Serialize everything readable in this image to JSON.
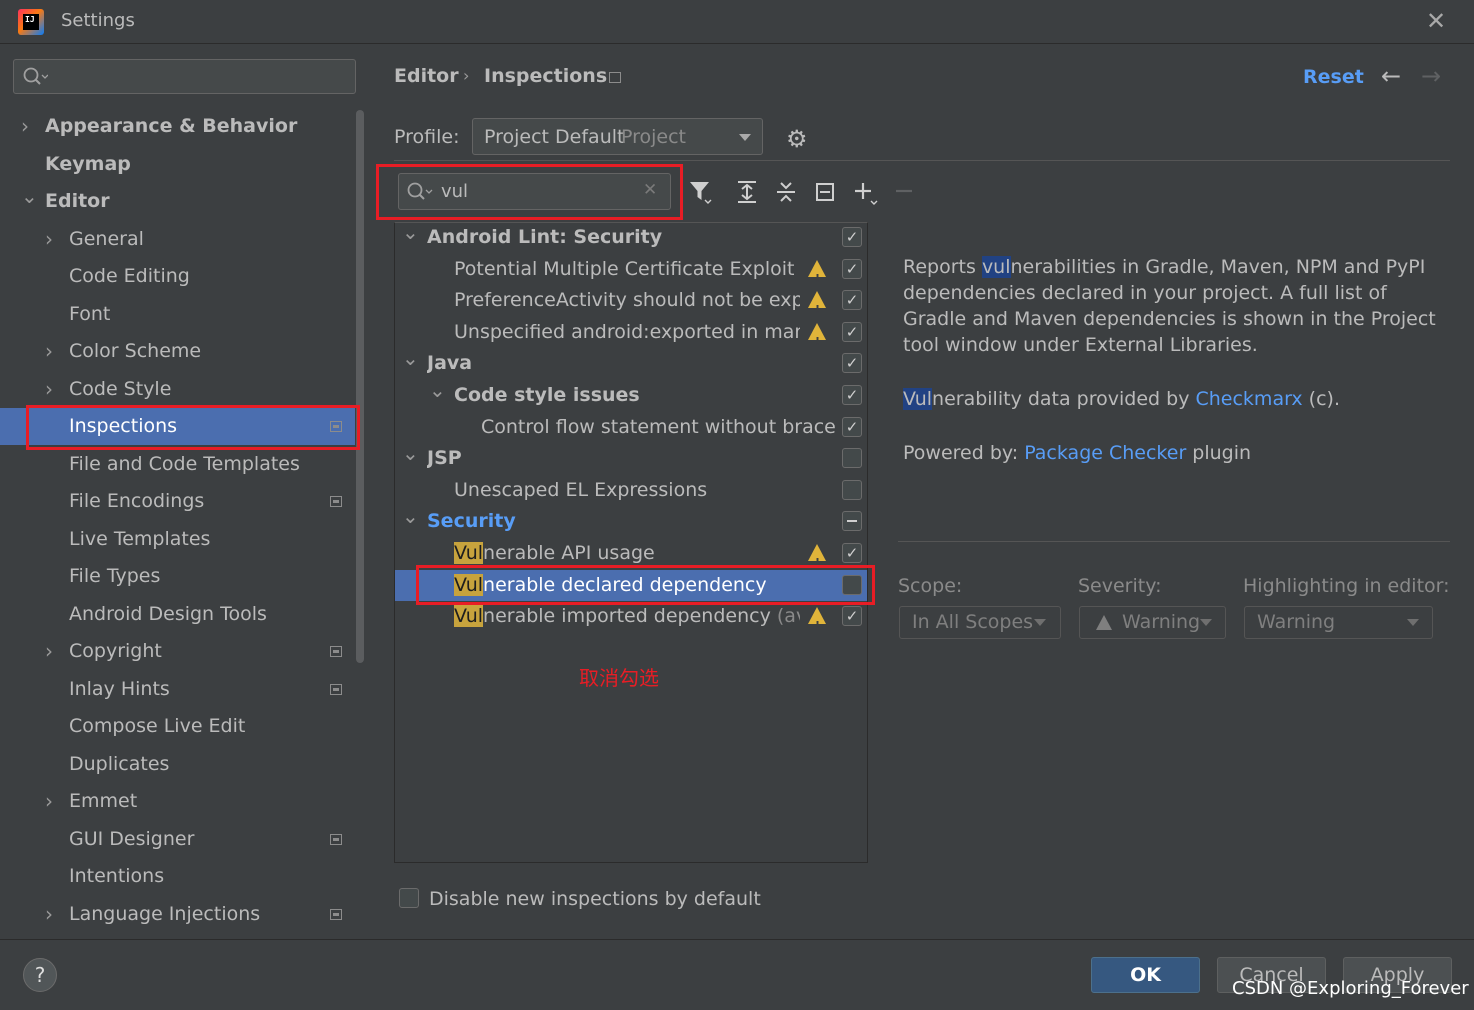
{
  "window": {
    "title": "Settings",
    "app_icon": "intellij-idea-icon",
    "close_icon": "close-icon"
  },
  "sidebar": {
    "search_placeholder": "",
    "items": [
      {
        "label": "Appearance & Behavior",
        "level": 0,
        "expandable": true,
        "expanded": false,
        "bold": true
      },
      {
        "label": "Keymap",
        "level": 0,
        "expandable": false,
        "bold": true
      },
      {
        "label": "Editor",
        "level": 0,
        "expandable": true,
        "expanded": true,
        "bold": true
      },
      {
        "label": "General",
        "level": 1,
        "expandable": true
      },
      {
        "label": "Code Editing",
        "level": 1
      },
      {
        "label": "Font",
        "level": 1
      },
      {
        "label": "Color Scheme",
        "level": 1,
        "expandable": true
      },
      {
        "label": "Code Style",
        "level": 1,
        "expandable": true
      },
      {
        "label": "Inspections",
        "level": 1,
        "selected": true,
        "modified": true
      },
      {
        "label": "File and Code Templates",
        "level": 1
      },
      {
        "label": "File Encodings",
        "level": 1,
        "modified": true
      },
      {
        "label": "Live Templates",
        "level": 1
      },
      {
        "label": "File Types",
        "level": 1
      },
      {
        "label": "Android Design Tools",
        "level": 1
      },
      {
        "label": "Copyright",
        "level": 1,
        "expandable": true,
        "modified": true
      },
      {
        "label": "Inlay Hints",
        "level": 1,
        "modified": true
      },
      {
        "label": "Compose Live Edit",
        "level": 1
      },
      {
        "label": "Duplicates",
        "level": 1
      },
      {
        "label": "Emmet",
        "level": 1,
        "expandable": true
      },
      {
        "label": "GUI Designer",
        "level": 1,
        "modified": true
      },
      {
        "label": "Intentions",
        "level": 1
      },
      {
        "label": "Language Injections",
        "level": 1,
        "expandable": true,
        "modified": true
      }
    ]
  },
  "header": {
    "breadcrumb": [
      "Editor",
      "Inspections"
    ],
    "reset_label": "Reset",
    "back_icon": "arrow-left-icon",
    "forward_icon": "arrow-right-icon"
  },
  "profile": {
    "label": "Profile:",
    "value": "Project Default",
    "sub": "Project",
    "gear_icon": "gear-icon"
  },
  "filter": {
    "value": "vul"
  },
  "toolbar_icons": [
    "filter-icon",
    "expand-all-icon",
    "collapse-all-icon",
    "reset-to-default-icon",
    "add-icon",
    "remove-icon"
  ],
  "tree": [
    {
      "label": "Android Lint: Security",
      "level": 0,
      "group": true,
      "checked": "checked"
    },
    {
      "label": "Potential Multiple Certificate Exploit",
      "level": 1,
      "warning": true,
      "checked": "checked"
    },
    {
      "label": "PreferenceActivity should not be exporte",
      "level": 1,
      "warning": true,
      "checked": "checked"
    },
    {
      "label": "Unspecified android:exported in manifes",
      "level": 1,
      "warning": true,
      "checked": "checked"
    },
    {
      "label": "Java",
      "level": 0,
      "group": true,
      "checked": "checked"
    },
    {
      "label": "Code style issues",
      "level": 1,
      "group": true,
      "checked": "checked"
    },
    {
      "label": "Control flow statement without brace",
      "level": 2,
      "checked": "checked"
    },
    {
      "label": "JSP",
      "level": 0,
      "group": true,
      "checked": "unchecked"
    },
    {
      "label": "Unescaped EL Expressions",
      "level": 1,
      "checked": "unchecked"
    },
    {
      "label": "Security",
      "level": 0,
      "group": true,
      "modified": true,
      "checked": "partial"
    },
    {
      "label_hl": "Vul",
      "label_rest": "nerable API usage",
      "level": 1,
      "warning": true,
      "checked": "checked"
    },
    {
      "label_hl": "Vul",
      "label_rest": "nerable declared dependency",
      "level": 1,
      "selected": true,
      "checked": "unchecked"
    },
    {
      "label_hl": "Vul",
      "label_rest": "nerable imported dependency",
      "label_dim": " (availa",
      "level": 1,
      "warning": true,
      "checked": "checked"
    }
  ],
  "description": {
    "p1_a": "Reports ",
    "p1_hl": "vul",
    "p1_b": "nerabilities in Gradle, Maven, NPM and PyPI dependencies declared in your project. A full list of Gradle and Maven dependencies is shown in the Project tool window under External Libraries.",
    "p2_hl": "Vul",
    "p2_a": "nerability data provided by ",
    "p2_link": "Checkmarx",
    "p2_b": " (c).",
    "p3_a": "Powered by: ",
    "p3_link": "Package Checker",
    "p3_b": " plugin"
  },
  "options": {
    "scope_label": "Scope:",
    "scope_value": "In All Scopes",
    "severity_label": "Severity:",
    "severity_value": "Warning",
    "highlight_label": "Highlighting in editor:",
    "highlight_value": "Warning"
  },
  "annotation": {
    "text": "取消勾选",
    "color": "#e81d25"
  },
  "disable_new": {
    "label": "Disable new inspections by default",
    "checked": false
  },
  "footer": {
    "ok": "OK",
    "cancel": "Cancel",
    "apply": "Apply",
    "help": "?"
  },
  "watermark": "CSDN @Exploring_Forever"
}
